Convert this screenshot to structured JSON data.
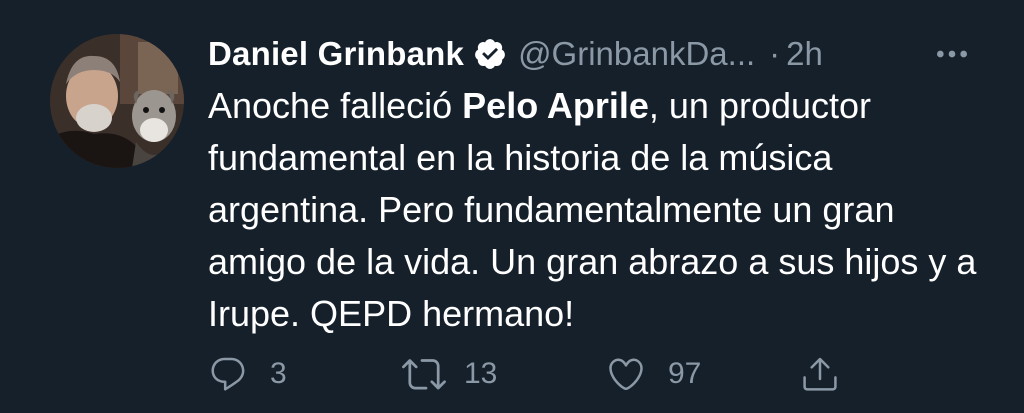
{
  "tweet": {
    "author_name": "Daniel Grinbank",
    "handle": "@GrinbankDa...",
    "separator": "·",
    "time": "2h",
    "verified": true,
    "text": {
      "part1": "Anoche falleció ",
      "bold": "Pelo Aprile",
      "part2": ", un productor fundamental en la historia de la música argentina. Pero fundamentalmente un gran amigo de la vida. Un gran abrazo a sus hijos y a Irupe. QEPD hermano!"
    }
  },
  "actions": {
    "reply_count": "3",
    "retweet_count": "13",
    "like_count": "97"
  },
  "icons": {
    "verified": "verified-badge-icon",
    "more": "more-options-icon",
    "reply": "reply-icon",
    "retweet": "retweet-icon",
    "like": "heart-icon",
    "share": "share-icon"
  },
  "colors": {
    "background": "#15202b",
    "text": "#ffffff",
    "secondary": "#8b98a5"
  }
}
